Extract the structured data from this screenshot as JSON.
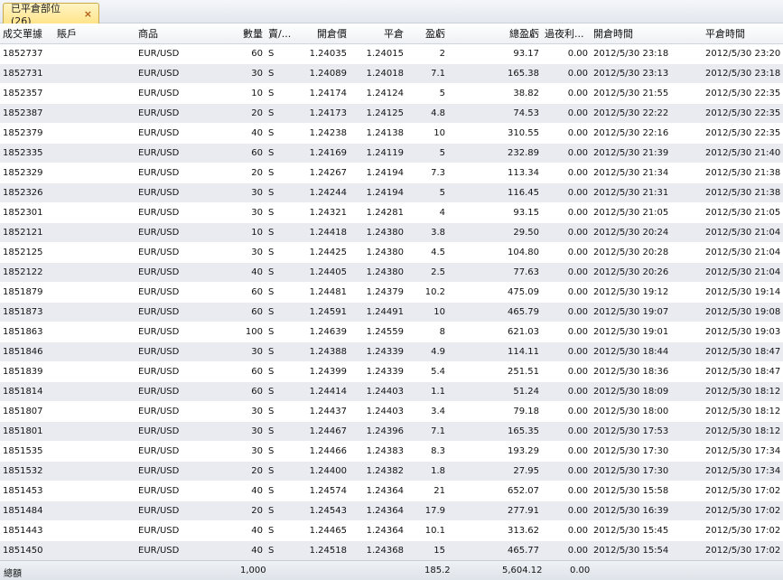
{
  "tab": {
    "label": "已平倉部位 (26)",
    "close_symbol": "×"
  },
  "columns": [
    "成交單據",
    "賬戶",
    "商品",
    "數量",
    "賣/...",
    "開倉價",
    "平倉",
    "盈虧",
    "總盈虧",
    "過夜利...",
    "開倉時間",
    "平倉時間"
  ],
  "rows": [
    [
      "1852737",
      "",
      "EUR/USD",
      "60",
      "S",
      "1.24035",
      "1.24015",
      "2",
      "93.17",
      "0.00",
      "2012/5/30 23:18",
      "2012/5/30 23:20"
    ],
    [
      "1852731",
      "",
      "EUR/USD",
      "30",
      "S",
      "1.24089",
      "1.24018",
      "7.1",
      "165.38",
      "0.00",
      "2012/5/30 23:13",
      "2012/5/30 23:18"
    ],
    [
      "1852357",
      "",
      "EUR/USD",
      "10",
      "S",
      "1.24174",
      "1.24124",
      "5",
      "38.82",
      "0.00",
      "2012/5/30 21:55",
      "2012/5/30 22:35"
    ],
    [
      "1852387",
      "",
      "EUR/USD",
      "20",
      "S",
      "1.24173",
      "1.24125",
      "4.8",
      "74.53",
      "0.00",
      "2012/5/30 22:22",
      "2012/5/30 22:35"
    ],
    [
      "1852379",
      "",
      "EUR/USD",
      "40",
      "S",
      "1.24238",
      "1.24138",
      "10",
      "310.55",
      "0.00",
      "2012/5/30 22:16",
      "2012/5/30 22:35"
    ],
    [
      "1852335",
      "",
      "EUR/USD",
      "60",
      "S",
      "1.24169",
      "1.24119",
      "5",
      "232.89",
      "0.00",
      "2012/5/30 21:39",
      "2012/5/30 21:40"
    ],
    [
      "1852329",
      "",
      "EUR/USD",
      "20",
      "S",
      "1.24267",
      "1.24194",
      "7.3",
      "113.34",
      "0.00",
      "2012/5/30 21:34",
      "2012/5/30 21:38"
    ],
    [
      "1852326",
      "",
      "EUR/USD",
      "30",
      "S",
      "1.24244",
      "1.24194",
      "5",
      "116.45",
      "0.00",
      "2012/5/30 21:31",
      "2012/5/30 21:38"
    ],
    [
      "1852301",
      "",
      "EUR/USD",
      "30",
      "S",
      "1.24321",
      "1.24281",
      "4",
      "93.15",
      "0.00",
      "2012/5/30 21:05",
      "2012/5/30 21:05"
    ],
    [
      "1852121",
      "",
      "EUR/USD",
      "10",
      "S",
      "1.24418",
      "1.24380",
      "3.8",
      "29.50",
      "0.00",
      "2012/5/30 20:24",
      "2012/5/30 21:04"
    ],
    [
      "1852125",
      "",
      "EUR/USD",
      "30",
      "S",
      "1.24425",
      "1.24380",
      "4.5",
      "104.80",
      "0.00",
      "2012/5/30 20:28",
      "2012/5/30 21:04"
    ],
    [
      "1852122",
      "",
      "EUR/USD",
      "40",
      "S",
      "1.24405",
      "1.24380",
      "2.5",
      "77.63",
      "0.00",
      "2012/5/30 20:26",
      "2012/5/30 21:04"
    ],
    [
      "1851879",
      "",
      "EUR/USD",
      "60",
      "S",
      "1.24481",
      "1.24379",
      "10.2",
      "475.09",
      "0.00",
      "2012/5/30 19:12",
      "2012/5/30 19:14"
    ],
    [
      "1851873",
      "",
      "EUR/USD",
      "60",
      "S",
      "1.24591",
      "1.24491",
      "10",
      "465.79",
      "0.00",
      "2012/5/30 19:07",
      "2012/5/30 19:08"
    ],
    [
      "1851863",
      "",
      "EUR/USD",
      "100",
      "S",
      "1.24639",
      "1.24559",
      "8",
      "621.03",
      "0.00",
      "2012/5/30 19:01",
      "2012/5/30 19:03"
    ],
    [
      "1851846",
      "",
      "EUR/USD",
      "30",
      "S",
      "1.24388",
      "1.24339",
      "4.9",
      "114.11",
      "0.00",
      "2012/5/30 18:44",
      "2012/5/30 18:47"
    ],
    [
      "1851839",
      "",
      "EUR/USD",
      "60",
      "S",
      "1.24399",
      "1.24339",
      "5.4",
      "251.51",
      "0.00",
      "2012/5/30 18:36",
      "2012/5/30 18:47"
    ],
    [
      "1851814",
      "",
      "EUR/USD",
      "60",
      "S",
      "1.24414",
      "1.24403",
      "1.1",
      "51.24",
      "0.00",
      "2012/5/30 18:09",
      "2012/5/30 18:12"
    ],
    [
      "1851807",
      "",
      "EUR/USD",
      "30",
      "S",
      "1.24437",
      "1.24403",
      "3.4",
      "79.18",
      "0.00",
      "2012/5/30 18:00",
      "2012/5/30 18:12"
    ],
    [
      "1851801",
      "",
      "EUR/USD",
      "30",
      "S",
      "1.24467",
      "1.24396",
      "7.1",
      "165.35",
      "0.00",
      "2012/5/30 17:53",
      "2012/5/30 18:12"
    ],
    [
      "1851535",
      "",
      "EUR/USD",
      "30",
      "S",
      "1.24466",
      "1.24383",
      "8.3",
      "193.29",
      "0.00",
      "2012/5/30 17:30",
      "2012/5/30 17:34"
    ],
    [
      "1851532",
      "",
      "EUR/USD",
      "20",
      "S",
      "1.24400",
      "1.24382",
      "1.8",
      "27.95",
      "0.00",
      "2012/5/30 17:30",
      "2012/5/30 17:34"
    ],
    [
      "1851453",
      "",
      "EUR/USD",
      "40",
      "S",
      "1.24574",
      "1.24364",
      "21",
      "652.07",
      "0.00",
      "2012/5/30 15:58",
      "2012/5/30 17:02"
    ],
    [
      "1851484",
      "",
      "EUR/USD",
      "20",
      "S",
      "1.24543",
      "1.24364",
      "17.9",
      "277.91",
      "0.00",
      "2012/5/30 16:39",
      "2012/5/30 17:02"
    ],
    [
      "1851443",
      "",
      "EUR/USD",
      "40",
      "S",
      "1.24465",
      "1.24364",
      "10.1",
      "313.62",
      "0.00",
      "2012/5/30 15:45",
      "2012/5/30 17:02"
    ],
    [
      "1851450",
      "",
      "EUR/USD",
      "40",
      "S",
      "1.24518",
      "1.24368",
      "15",
      "465.77",
      "0.00",
      "2012/5/30 15:54",
      "2012/5/30 17:02"
    ]
  ],
  "footer": {
    "label": "總額",
    "quantity": "1,000",
    "pips": "185.2",
    "total_pnl": "5,604.12",
    "rollover": "0.00"
  },
  "colors": {
    "tab_active": "#ffe48a",
    "row_alt": "#e9ebf1",
    "close_icon": "#b35a14"
  }
}
